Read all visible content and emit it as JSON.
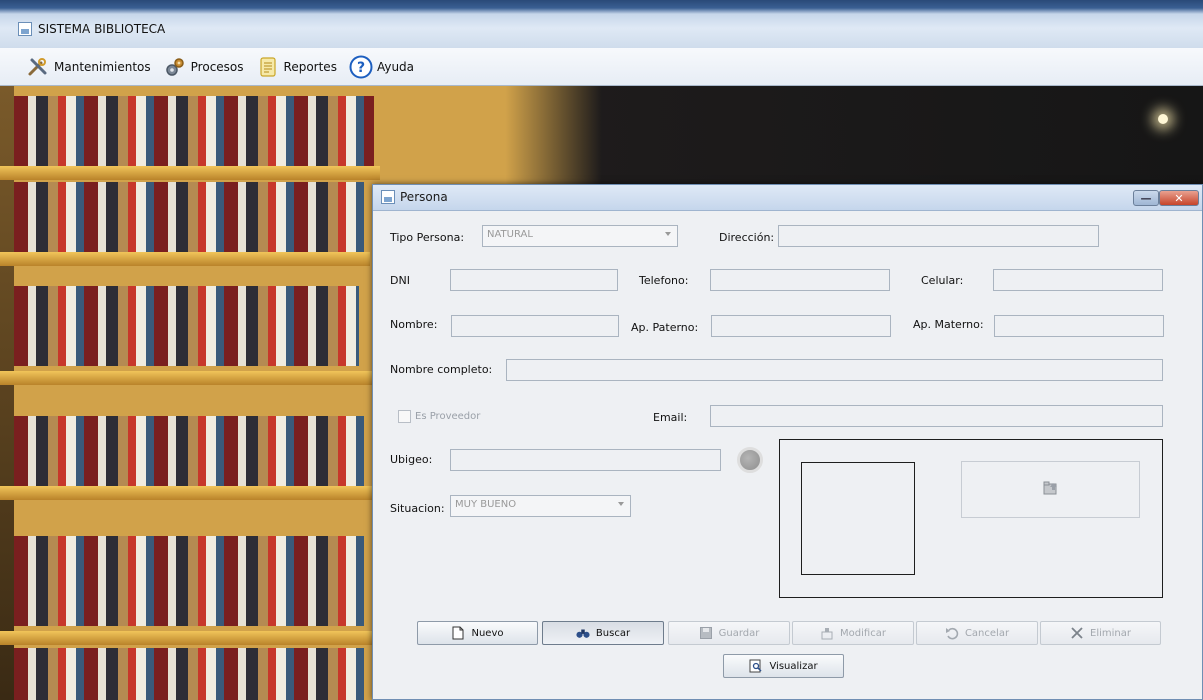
{
  "window": {
    "title": "SISTEMA BIBLIOTECA"
  },
  "menu": [
    {
      "label": "Mantenimientos",
      "icon": "tools-icon"
    },
    {
      "label": "Procesos",
      "icon": "gears-icon"
    },
    {
      "label": "Reportes",
      "icon": "report-icon"
    },
    {
      "label": "Ayuda",
      "icon": "help-icon"
    }
  ],
  "dialog": {
    "title": "Persona",
    "fields": {
      "tipo_persona": {
        "label": "Tipo Persona:",
        "value": "NATURAL"
      },
      "direccion": {
        "label": "Dirección:",
        "value": ""
      },
      "dni": {
        "label": "DNI",
        "value": ""
      },
      "telefono": {
        "label": "Telefono:",
        "value": ""
      },
      "celular": {
        "label": "Celular:",
        "value": ""
      },
      "nombre": {
        "label": "Nombre:",
        "value": ""
      },
      "ap_paterno": {
        "label": "Ap. Paterno:",
        "value": ""
      },
      "ap_materno": {
        "label": "Ap. Materno:",
        "value": ""
      },
      "nombre_completo": {
        "label": "Nombre completo:",
        "value": ""
      },
      "es_proveedor": {
        "label": "Es Proveedor",
        "checked": false
      },
      "email": {
        "label": "Email:",
        "value": ""
      },
      "ubigeo": {
        "label": "Ubigeo:",
        "value": ""
      },
      "situacion": {
        "label": "Situacion:",
        "value": "MUY BUENO"
      }
    },
    "buttons": {
      "nuevo": "Nuevo",
      "buscar": "Buscar",
      "guardar": "Guardar",
      "modificar": "Modificar",
      "cancelar": "Cancelar",
      "eliminar": "Eliminar",
      "visualizar": "Visualizar"
    }
  },
  "colors": {
    "titlebar": "#c6d6ea",
    "dialog_bg": "#eef0f3",
    "close_button": "#c6442a",
    "help_icon": "#1d5fc0"
  }
}
